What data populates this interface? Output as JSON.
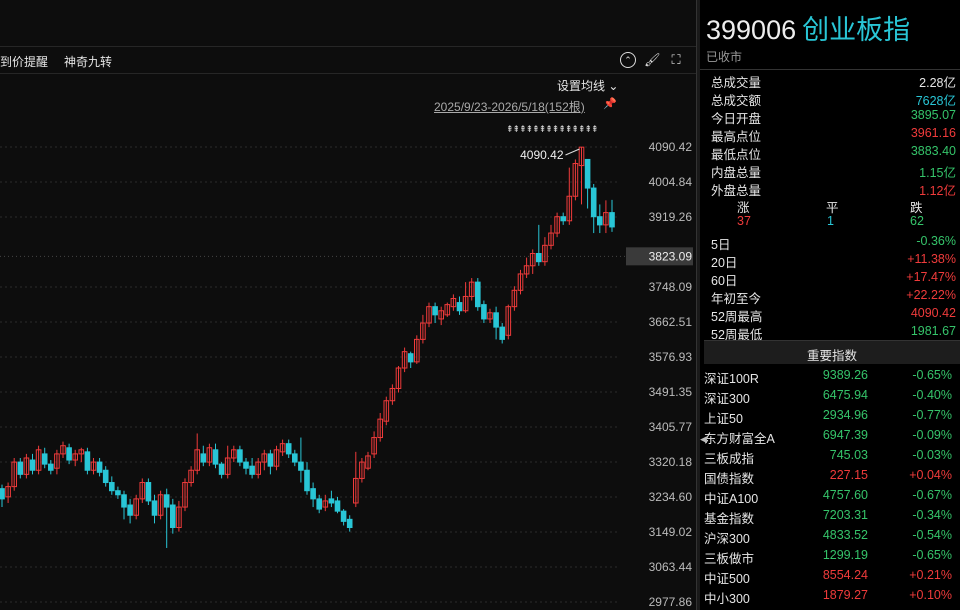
{
  "toolbar": {
    "alert_label": "到价提醒",
    "jiuzhuan_label": "神奇九转",
    "ma_settings_label": "设置均线",
    "collapse_icon": "chevron-up-circle-icon",
    "draw_icon": "brush-icon",
    "fullscreen_icon": "fullscreen-icon"
  },
  "chart": {
    "range_label": "2025/9/23-2026/5/18(152根)",
    "marker_row": "⇞⇞⇞⇞⇞⇞⇞⇞⇞⇞⇞⇞⇞⇞",
    "high_annotation": "4090.42",
    "current_price_tag": "3823.09",
    "colors": {
      "up": "#ef3b3b",
      "down": "#29c6d6",
      "grid": "#2a2a2a"
    }
  },
  "chart_data": {
    "type": "candlestick",
    "y_axis_ticks": [
      "4090.42",
      "4004.84",
      "3919.26",
      "3823.09",
      "3748.09",
      "3662.51",
      "3576.93",
      "3491.35",
      "3405.77",
      "3320.18",
      "3234.60",
      "3149.02",
      "3063.44",
      "2977.86"
    ],
    "ylim": [
      2977.86,
      4090.42
    ],
    "candles": [
      [
        3360,
        3400,
        3340,
        3410
      ],
      [
        3390,
        3360,
        3350,
        3405
      ],
      [
        3360,
        3320,
        3310,
        3370
      ],
      [
        3320,
        3340,
        3300,
        3350
      ],
      [
        3340,
        3295,
        3280,
        3350
      ],
      [
        3300,
        3330,
        3290,
        3340
      ],
      [
        3330,
        3345,
        3315,
        3360
      ],
      [
        3340,
        3310,
        3300,
        3350
      ],
      [
        3310,
        3345,
        3300,
        3355
      ],
      [
        3345,
        3325,
        3315,
        3360
      ],
      [
        3320,
        3360,
        3310,
        3370
      ],
      [
        3355,
        3330,
        3310,
        3365
      ],
      [
        3330,
        3290,
        3280,
        3345
      ],
      [
        3295,
        3315,
        3280,
        3325
      ],
      [
        3315,
        3335,
        3300,
        3345
      ],
      [
        3335,
        3300,
        3290,
        3345
      ],
      [
        3300,
        3260,
        3250,
        3310
      ],
      [
        3260,
        3285,
        3240,
        3295
      ],
      [
        3290,
        3255,
        3240,
        3300
      ],
      [
        3255,
        3230,
        3210,
        3265
      ],
      [
        3235,
        3260,
        3220,
        3270
      ],
      [
        3260,
        3320,
        3250,
        3330
      ],
      [
        3320,
        3290,
        3280,
        3330
      ],
      [
        3290,
        3330,
        3280,
        3340
      ],
      [
        3325,
        3300,
        3290,
        3340
      ],
      [
        3300,
        3350,
        3290,
        3360
      ],
      [
        3340,
        3315,
        3305,
        3355
      ],
      [
        3315,
        3300,
        3290,
        3325
      ],
      [
        3305,
        3340,
        3290,
        3350
      ],
      [
        3340,
        3360,
        3330,
        3370
      ],
      [
        3355,
        3325,
        3315,
        3365
      ],
      [
        3325,
        3340,
        3310,
        3350
      ],
      [
        3340,
        3350,
        3320,
        3355
      ],
      [
        3345,
        3300,
        3290,
        3355
      ],
      [
        3300,
        3320,
        3290,
        3330
      ],
      [
        3320,
        3295,
        3285,
        3330
      ],
      [
        3300,
        3270,
        3260,
        3310
      ],
      [
        3270,
        3250,
        3240,
        3285
      ],
      [
        3250,
        3240,
        3230,
        3260
      ],
      [
        3240,
        3210,
        3180,
        3250
      ],
      [
        3215,
        3190,
        3170,
        3230
      ],
      [
        3190,
        3230,
        3180,
        3240
      ],
      [
        3230,
        3270,
        3220,
        3280
      ],
      [
        3270,
        3225,
        3215,
        3280
      ],
      [
        3225,
        3190,
        3170,
        3240
      ],
      [
        3190,
        3240,
        3180,
        3250
      ],
      [
        3240,
        3210,
        3110,
        3255
      ],
      [
        3215,
        3160,
        3145,
        3230
      ],
      [
        3160,
        3210,
        3150,
        3225
      ],
      [
        3210,
        3270,
        3200,
        3280
      ],
      [
        3270,
        3300,
        3260,
        3310
      ],
      [
        3300,
        3350,
        3290,
        3390
      ],
      [
        3340,
        3320,
        3310,
        3360
      ],
      [
        3320,
        3355,
        3310,
        3365
      ],
      [
        3350,
        3315,
        3305,
        3365
      ],
      [
        3315,
        3290,
        3280,
        3320
      ],
      [
        3290,
        3330,
        3280,
        3360
      ],
      [
        3330,
        3350,
        3320,
        3360
      ],
      [
        3350,
        3320,
        3310,
        3360
      ],
      [
        3320,
        3305,
        3290,
        3330
      ],
      [
        3310,
        3290,
        3280,
        3330
      ],
      [
        3290,
        3320,
        3280,
        3330
      ],
      [
        3320,
        3340,
        3300,
        3350
      ],
      [
        3340,
        3310,
        3290,
        3350
      ],
      [
        3310,
        3350,
        3300,
        3360
      ],
      [
        3345,
        3365,
        3335,
        3375
      ],
      [
        3365,
        3340,
        3330,
        3375
      ],
      [
        3340,
        3320,
        3310,
        3350
      ],
      [
        3320,
        3300,
        3270,
        3380
      ],
      [
        3300,
        3250,
        3240,
        3320
      ],
      [
        3255,
        3230,
        3210,
        3270
      ],
      [
        3230,
        3205,
        3195,
        3240
      ],
      [
        3210,
        3225,
        3200,
        3240
      ],
      [
        3230,
        3220,
        3210,
        3250
      ],
      [
        3225,
        3200,
        3195,
        3235
      ],
      [
        3200,
        3175,
        3165,
        3205
      ],
      [
        3180,
        3160,
        3150,
        3190
      ],
      [
        3220,
        3280,
        3210,
        3345
      ],
      [
        3280,
        3320,
        3270,
        3330
      ],
      [
        3305,
        3335,
        3300,
        3345
      ],
      [
        3340,
        3380,
        3330,
        3395
      ],
      [
        3380,
        3425,
        3370,
        3440
      ],
      [
        3420,
        3470,
        3410,
        3480
      ],
      [
        3470,
        3500,
        3460,
        3510
      ],
      [
        3500,
        3550,
        3490,
        3555
      ],
      [
        3550,
        3590,
        3540,
        3600
      ],
      [
        3585,
        3565,
        3550,
        3590
      ],
      [
        3565,
        3620,
        3560,
        3630
      ],
      [
        3620,
        3660,
        3610,
        3680
      ],
      [
        3660,
        3700,
        3650,
        3710
      ],
      [
        3700,
        3680,
        3660,
        3710
      ],
      [
        3670,
        3690,
        3655,
        3700
      ],
      [
        3680,
        3705,
        3675,
        3710
      ],
      [
        3700,
        3720,
        3690,
        3730
      ],
      [
        3710,
        3690,
        3680,
        3725
      ],
      [
        3690,
        3725,
        3685,
        3760
      ],
      [
        3725,
        3760,
        3715,
        3770
      ],
      [
        3760,
        3700,
        3690,
        3770
      ],
      [
        3705,
        3670,
        3660,
        3715
      ],
      [
        3670,
        3685,
        3660,
        3695
      ],
      [
        3685,
        3650,
        3620,
        3700
      ],
      [
        3650,
        3620,
        3610,
        3660
      ],
      [
        3630,
        3700,
        3620,
        3705
      ],
      [
        3700,
        3740,
        3690,
        3750
      ],
      [
        3740,
        3780,
        3730,
        3790
      ],
      [
        3780,
        3800,
        3770,
        3820
      ],
      [
        3800,
        3830,
        3780,
        3840
      ],
      [
        3830,
        3810,
        3800,
        3900
      ],
      [
        3810,
        3850,
        3800,
        3870
      ],
      [
        3850,
        3880,
        3840,
        3900
      ],
      [
        3880,
        3920,
        3870,
        3930
      ],
      [
        3920,
        3910,
        3900,
        3930
      ],
      [
        3910,
        3970,
        3900,
        4040
      ],
      [
        3970,
        4050,
        3960,
        4060
      ],
      [
        4045,
        4090,
        3950,
        4090.42
      ],
      [
        4060,
        3990,
        3940,
        4060
      ],
      [
        3990,
        3920,
        3880,
        4000
      ],
      [
        3920,
        3900,
        3880,
        3950
      ],
      [
        3900,
        3930,
        3880,
        3960
      ],
      [
        3930,
        3895,
        3883,
        3961
      ]
    ]
  },
  "header": {
    "code": "399006",
    "name": "创业板指",
    "status": "已收市"
  },
  "stats": [
    {
      "label": "总成交量",
      "value": "2.28亿",
      "color": "white"
    },
    {
      "label": "总成交额",
      "value": "7628亿",
      "color": "cyan"
    },
    {
      "label": "今日开盘",
      "value": "3895.07",
      "color": "green"
    },
    {
      "label": "最高点位",
      "value": "3961.16",
      "color": "red"
    },
    {
      "label": "最低点位",
      "value": "3883.40",
      "color": "green"
    },
    {
      "label": "内盘总量",
      "value": "1.15亿",
      "color": "green"
    },
    {
      "label": "外盘总量",
      "value": "1.12亿",
      "color": "red"
    }
  ],
  "breadth": {
    "up_label": "涨",
    "flat_label": "平",
    "down_label": "跌",
    "up_count": "37",
    "flat_count": "1",
    "down_count": "62"
  },
  "periods": [
    {
      "label": "5日",
      "value": "-0.36%",
      "color": "green"
    },
    {
      "label": "20日",
      "value": "+11.38%",
      "color": "red"
    },
    {
      "label": "60日",
      "value": "+17.47%",
      "color": "red"
    },
    {
      "label": "年初至今",
      "value": "+22.22%",
      "color": "red"
    },
    {
      "label": "52周最高",
      "value": "4090.42",
      "color": "red"
    },
    {
      "label": "52周最低",
      "value": "1981.67",
      "color": "green"
    }
  ],
  "key_indices": {
    "title": "重要指数",
    "items": [
      {
        "name": "深证100R",
        "value": "9389.26",
        "change": "-0.65%",
        "color": "green"
      },
      {
        "name": "深证300",
        "value": "6475.94",
        "change": "-0.40%",
        "color": "green"
      },
      {
        "name": "上证50",
        "value": "2934.96",
        "change": "-0.77%",
        "color": "green"
      },
      {
        "name": "东方财富全A",
        "value": "6947.39",
        "change": "-0.09%",
        "color": "green"
      },
      {
        "name": "三板成指",
        "value": "745.03",
        "change": "-0.03%",
        "color": "green"
      },
      {
        "name": "国债指数",
        "value": "227.15",
        "change": "+0.04%",
        "color": "red"
      },
      {
        "name": "中证A100",
        "value": "4757.60",
        "change": "-0.67%",
        "color": "green"
      },
      {
        "name": "基金指数",
        "value": "7203.31",
        "change": "-0.34%",
        "color": "green"
      },
      {
        "name": "沪深300",
        "value": "4833.52",
        "change": "-0.54%",
        "color": "green"
      },
      {
        "name": "三板做市",
        "value": "1299.19",
        "change": "-0.65%",
        "color": "green"
      },
      {
        "name": "中证500",
        "value": "8554.24",
        "change": "+0.21%",
        "color": "red"
      },
      {
        "name": "中小300",
        "value": "1879.27",
        "change": "+0.10%",
        "color": "red"
      }
    ]
  }
}
